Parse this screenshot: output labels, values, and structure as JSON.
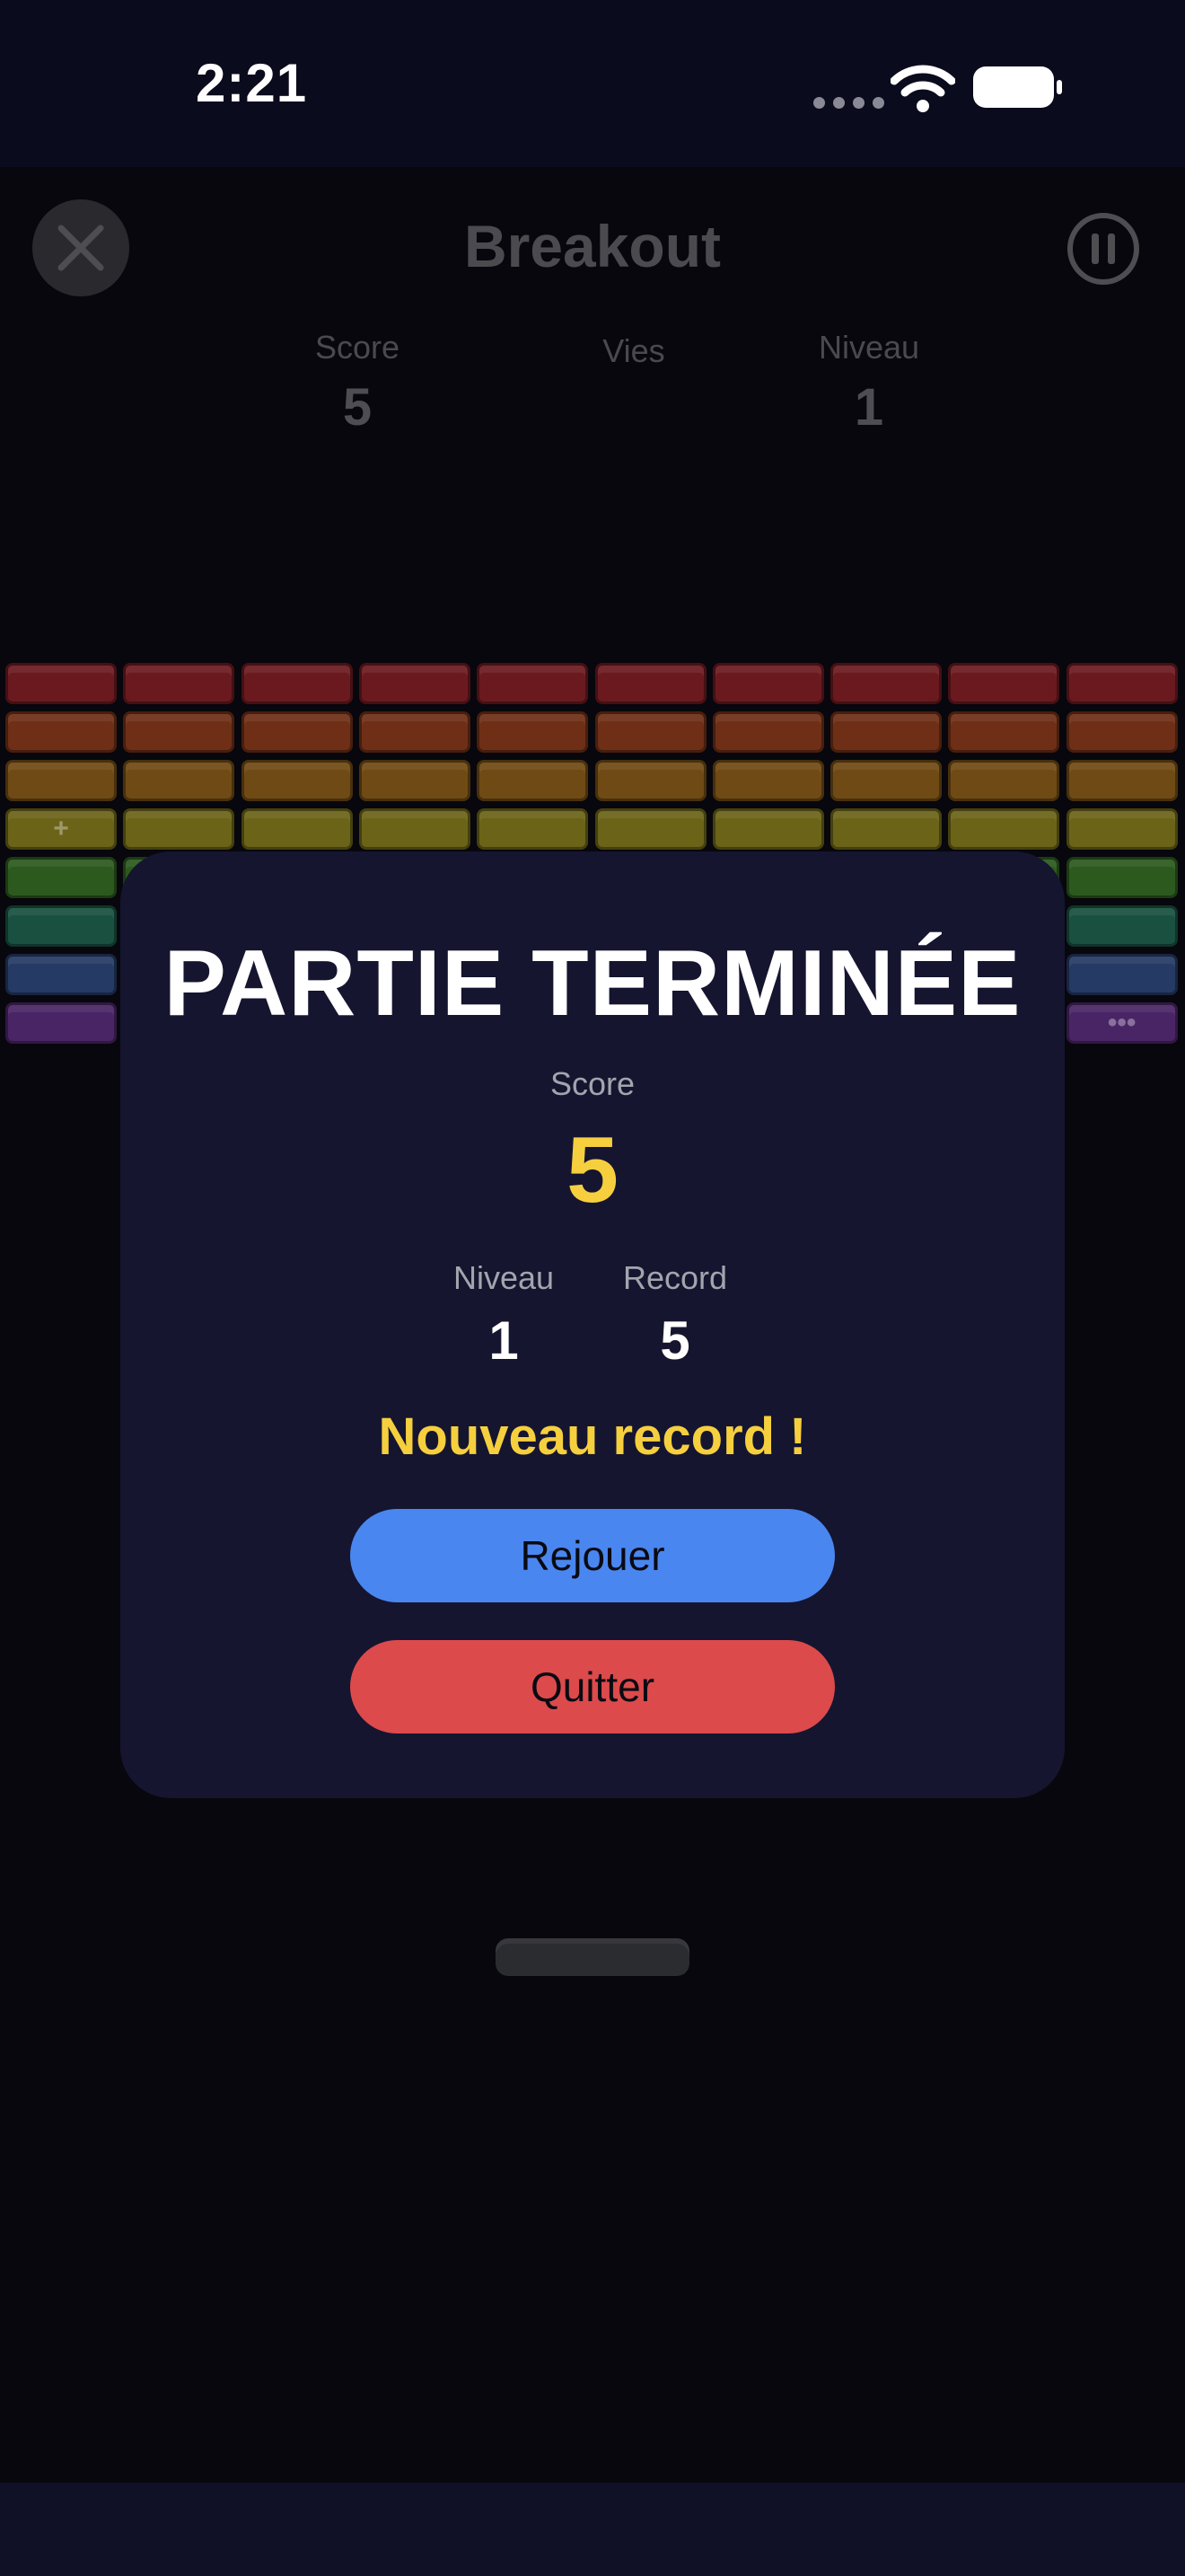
{
  "status_bar": {
    "time": "2:21"
  },
  "header": {
    "title": "Breakout"
  },
  "hud": {
    "score_label": "Score",
    "score_value": "5",
    "lives_label": "Vies",
    "level_label": "Niveau",
    "level_value": "1"
  },
  "bricks": {
    "row_colors": [
      "#6a1a1f",
      "#6e2f16",
      "#6f4a14",
      "#6b6318",
      "#2c5a1e",
      "#1a5040",
      "#253a64",
      "#4a2566"
    ],
    "columns": 10,
    "powerup_marks": {
      "left": "+",
      "right": "•••"
    }
  },
  "dialog": {
    "title": "PARTIE TERMINÉE",
    "score_label": "Score",
    "score_value": "5",
    "level_label": "Niveau",
    "level_value": "1",
    "record_label": "Record",
    "record_value": "5",
    "new_record": "Nouveau record !",
    "replay_label": "Rejouer",
    "quit_label": "Quitter"
  },
  "colors": {
    "accent_yellow": "#f6cf3e",
    "replay_blue": "#4a86ef",
    "quit_red": "#dc4a4b",
    "dialog_bg": "#151530"
  }
}
